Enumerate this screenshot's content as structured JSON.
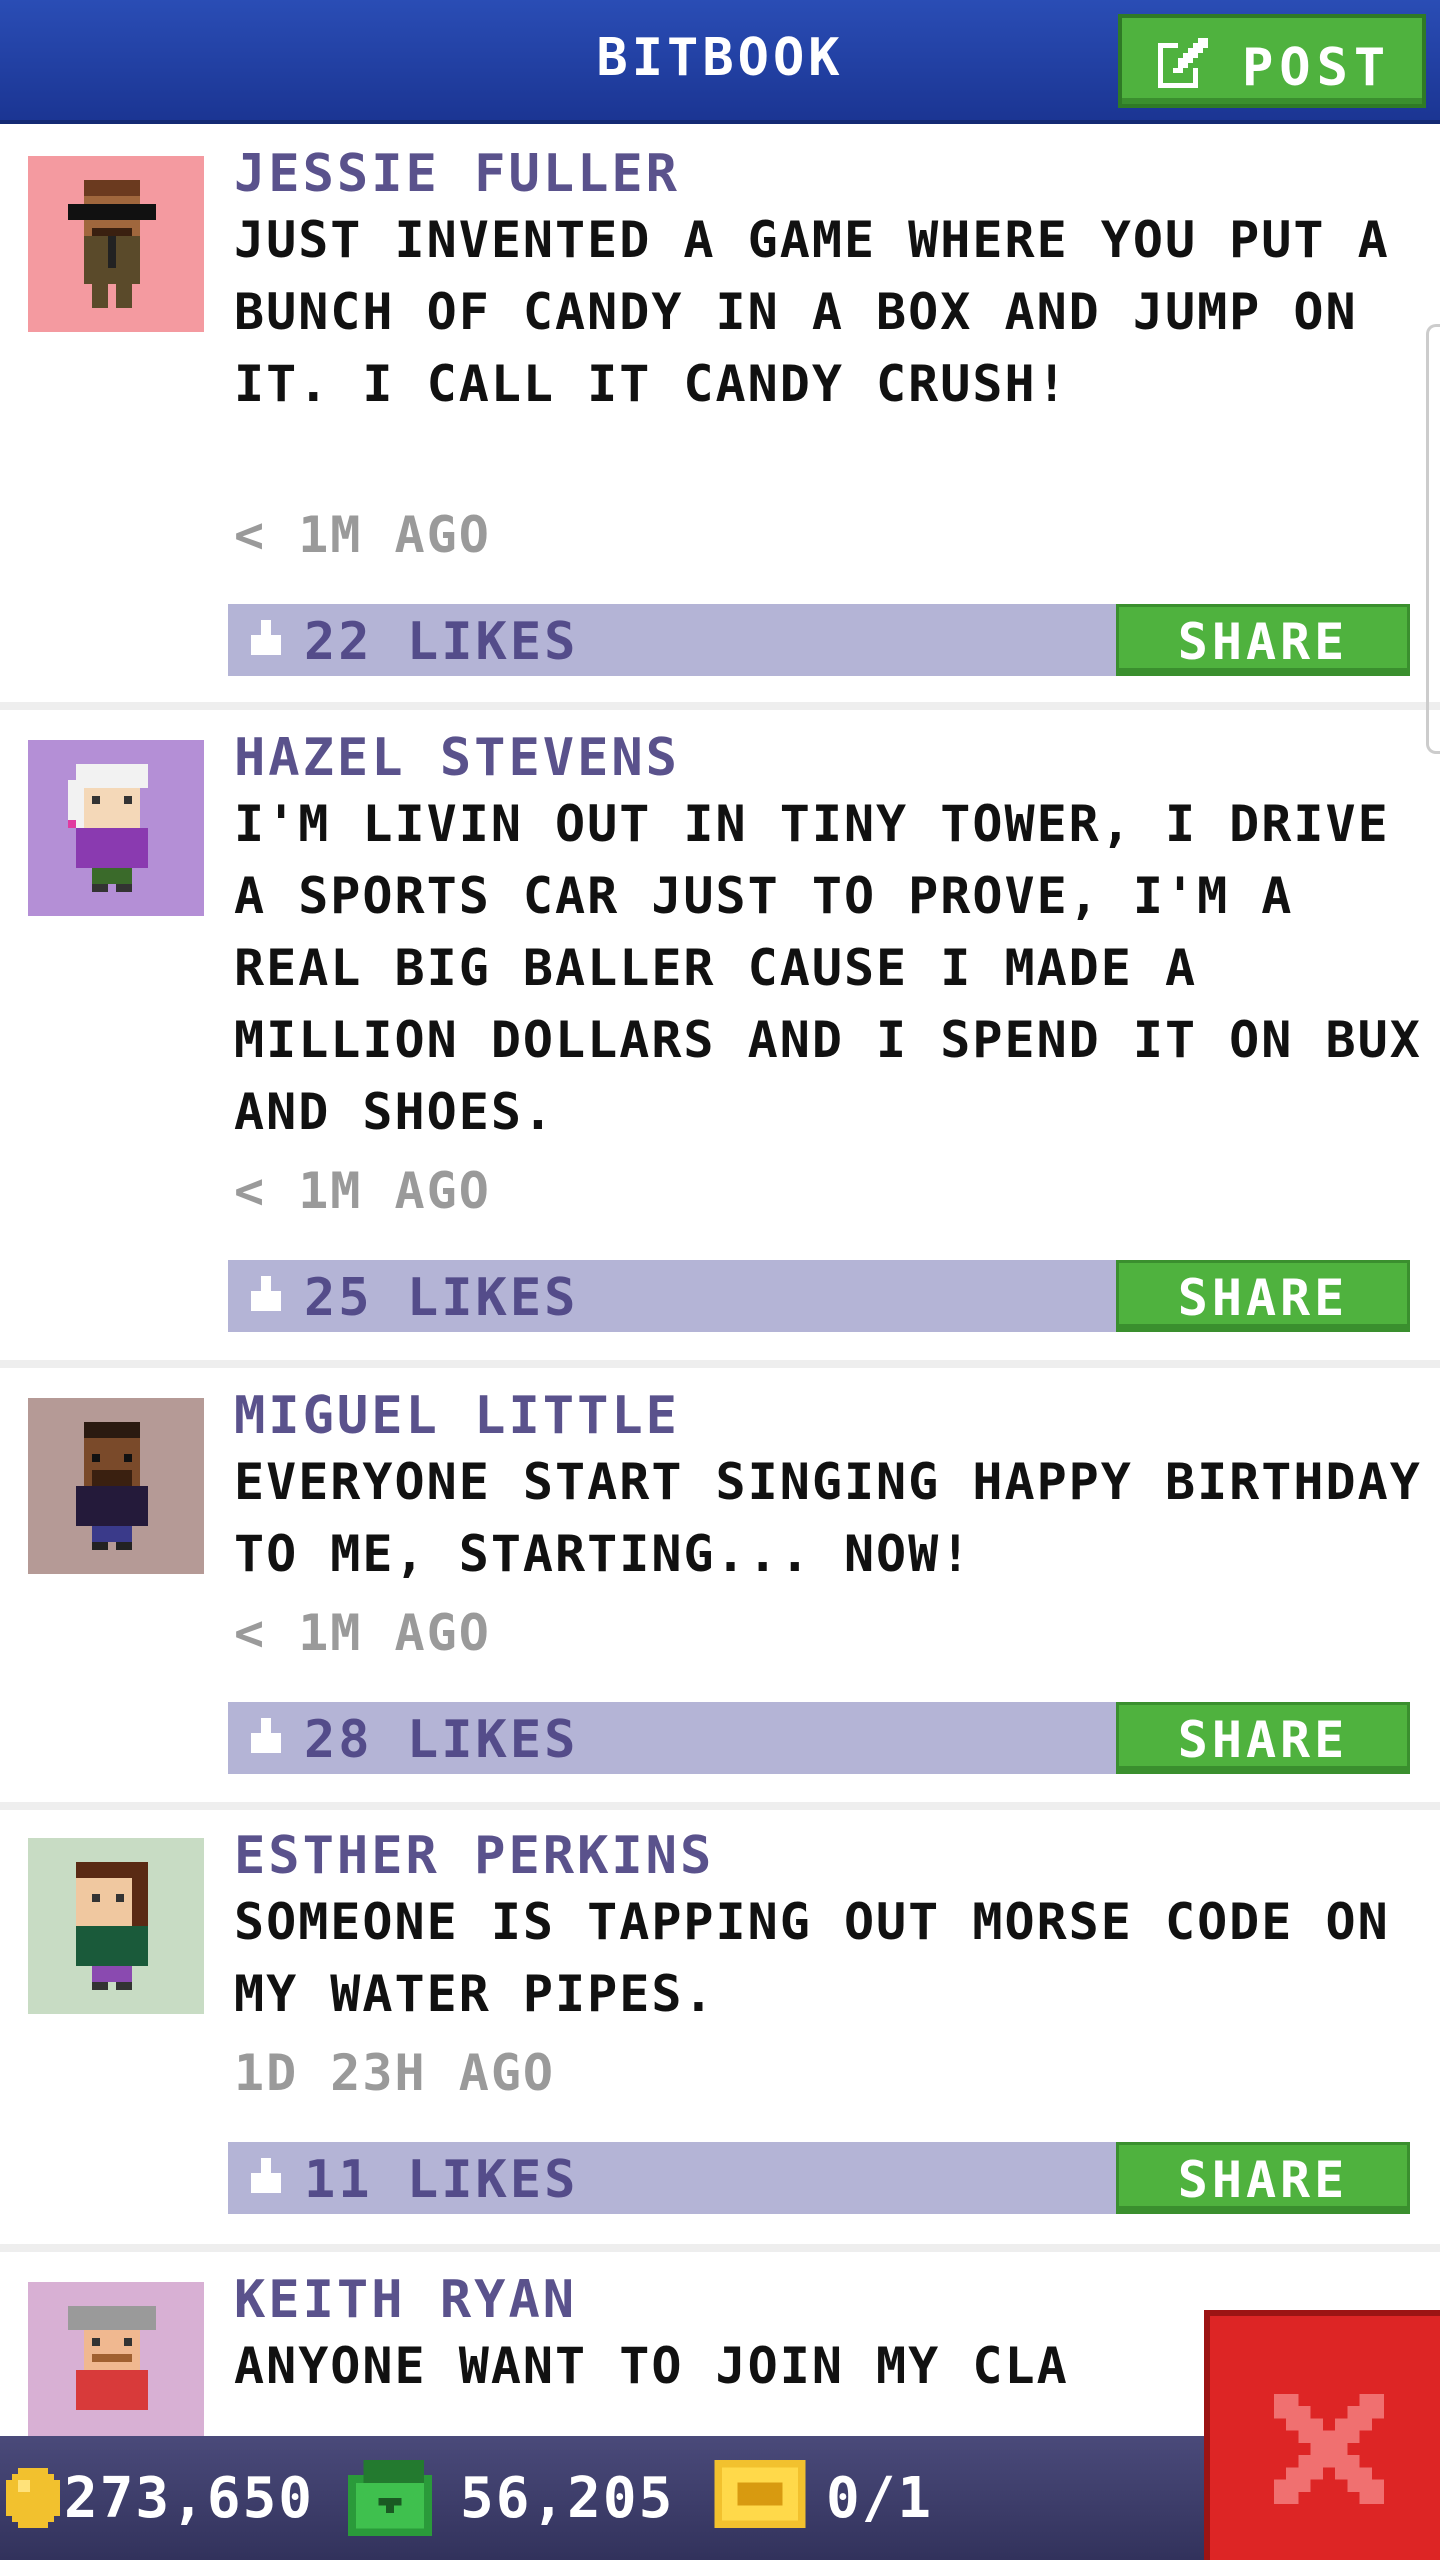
{
  "header": {
    "title": "BITBOOK",
    "post_label": "POST",
    "post_icon": "edit-icon"
  },
  "posts": [
    {
      "name": "JESSIE FULLER",
      "message": "JUST INVENTED A GAME WHERE YOU PUT A BUNCH OF CANDY IN A BOX AND JUMP ON IT. I CALL IT CANDY CRUSH!",
      "time": "< 1M AGO",
      "likes": "22 LIKES",
      "share": "SHARE",
      "avatar_bg": "#f49aa0"
    },
    {
      "name": "HAZEL STEVENS",
      "message": "I'M LIVIN OUT IN TINY TOWER, I DRIVE A SPORTS CAR JUST TO PROVE, I'M A REAL BIG BALLER CAUSE I MADE A MILLION DOLLARS AND I SPEND IT ON BUX AND SHOES.",
      "time": "< 1M AGO",
      "likes": "25 LIKES",
      "share": "SHARE",
      "avatar_bg": "#b48fd6"
    },
    {
      "name": "MIGUEL LITTLE",
      "message": "EVERYONE START SINGING HAPPY BIRTHDAY TO ME, STARTING... NOW!",
      "time": "< 1M AGO",
      "likes": "28 LIKES",
      "share": "SHARE",
      "avatar_bg": "#b59a96"
    },
    {
      "name": "ESTHER PERKINS",
      "message": "SOMEONE IS TAPPING OUT MORSE CODE ON MY WATER PIPES.",
      "time": "1D 23H AGO",
      "likes": "11 LIKES",
      "share": "SHARE",
      "avatar_bg": "#c8dcc4"
    },
    {
      "name": "KEITH RYAN",
      "message": "ANYONE WANT TO JOIN MY CLA",
      "avatar_bg": "#d8b0d4"
    }
  ],
  "footer": {
    "coins": "273,650",
    "bux": "56,205",
    "tickets": "0/1"
  },
  "colors": {
    "header_blue": "#1b3593",
    "accent_green": "#4fb23e",
    "like_bar": "#b4b4d6",
    "name_purple": "#5a528c",
    "close_red": "#dd2525"
  }
}
